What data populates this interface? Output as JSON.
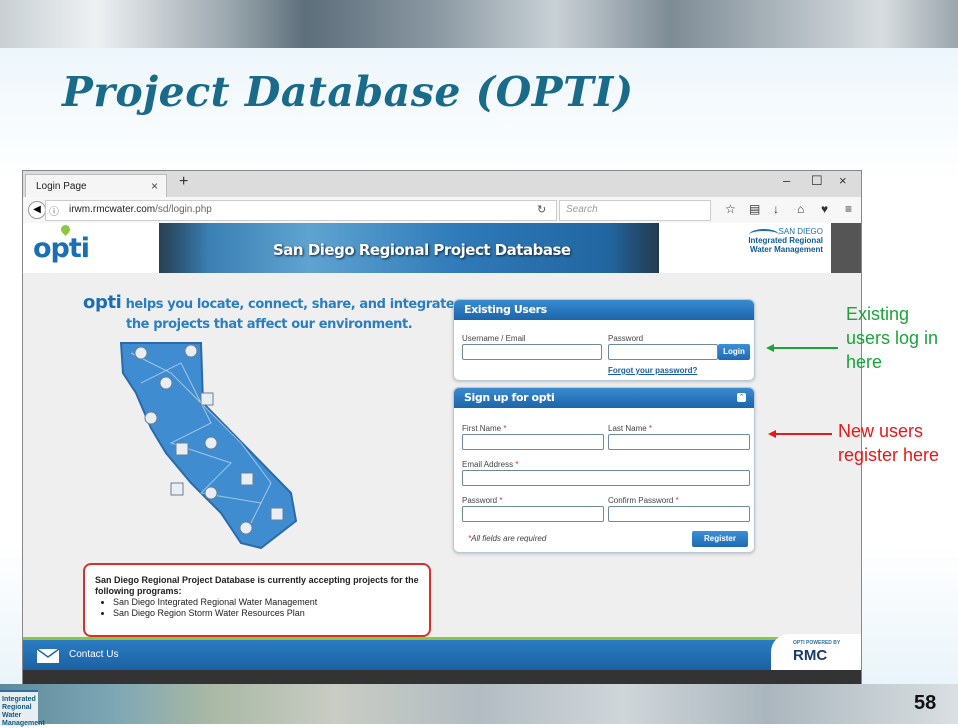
{
  "slide": {
    "title": "Project Database (OPTI)",
    "number": "58",
    "corner_logo": "Integrated Regional Water Management"
  },
  "browser": {
    "tab_label": "Login Page",
    "tab_close": "×",
    "new_tab": "+",
    "window_controls": [
      "–",
      "☐",
      "×"
    ],
    "url_host": "irwm.rmcwater.com",
    "url_path": "/sd/login.php",
    "search_placeholder": "Search",
    "toolbar_icons": [
      "star-icon",
      "bookmarks-icon",
      "download-icon",
      "home-icon",
      "pocket-icon",
      "menu-icon"
    ]
  },
  "site": {
    "logo": "opti",
    "banner_title": "San Diego Regional Project Database",
    "sd_logo": {
      "line1": "SAN DIEGO",
      "line2": "Integrated Regional",
      "line3": "Water Management"
    },
    "tagline_opti": "opti",
    "tagline_rest": "helps you locate, connect, share, and integrate",
    "tagline_line2": "the projects that affect our environment.",
    "existing": {
      "title": "Existing Users",
      "username_label": "Username / Email",
      "password_label": "Password",
      "login_button": "Login",
      "forgot_link": "Forgot your password?"
    },
    "signup": {
      "title": "Sign up for opti",
      "first_name": "First Name",
      "last_name": "Last Name",
      "email": "Email Address",
      "password": "Password",
      "confirm_password": "Confirm Password",
      "required_mark": "*",
      "required_note": "All fields are required",
      "register_button": "Register"
    },
    "notice": {
      "heading": "San Diego Regional Project Database is currently accepting projects for the following programs:",
      "items": [
        "San Diego Integrated Regional Water Management",
        "San Diego Region Storm Water Resources Plan"
      ]
    },
    "footer": {
      "contact": "Contact Us",
      "powered_by": "OPTI POWERED BY",
      "rmc": "RMC"
    }
  },
  "annotations": {
    "existing": "Existing users log in here",
    "new": "New users register here"
  },
  "colors": {
    "title": "#1a6a8a",
    "green_arrow": "#1aa33a",
    "red_arrow": "#e81818",
    "brand_blue": "#1a6fb3"
  }
}
